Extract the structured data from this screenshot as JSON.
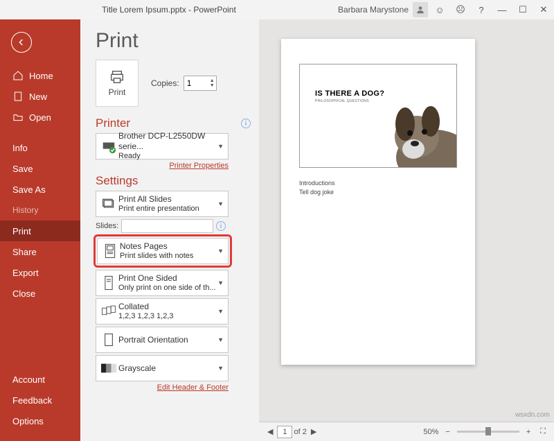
{
  "titlebar": {
    "title": "Title Lorem Ipsum.pptx - PowerPoint",
    "user": "Barbara Marystone"
  },
  "sidebar": {
    "back": "←",
    "top": [
      {
        "label": "Home",
        "icon": "home"
      },
      {
        "label": "New",
        "icon": "new"
      },
      {
        "label": "Open",
        "icon": "open"
      }
    ],
    "mid": [
      {
        "label": "Info"
      },
      {
        "label": "Save"
      },
      {
        "label": "Save As"
      },
      {
        "label": "History",
        "dim": true
      },
      {
        "label": "Print",
        "active": true
      },
      {
        "label": "Share"
      },
      {
        "label": "Export"
      },
      {
        "label": "Close"
      }
    ],
    "bottom": [
      {
        "label": "Account"
      },
      {
        "label": "Feedback"
      },
      {
        "label": "Options"
      }
    ]
  },
  "print": {
    "heading": "Print",
    "button": "Print",
    "copies_label": "Copies:",
    "copies_value": "1"
  },
  "printer": {
    "heading": "Printer",
    "name": "Brother DCP-L2550DW serie...",
    "status": "Ready",
    "link": "Printer Properties"
  },
  "settings": {
    "heading": "Settings",
    "range": {
      "title": "Print All Slides",
      "sub": "Print entire presentation"
    },
    "slides_label": "Slides:",
    "layout": {
      "title": "Notes Pages",
      "sub": "Print slides with notes"
    },
    "sides": {
      "title": "Print One Sided",
      "sub": "Only print on one side of th..."
    },
    "collate": {
      "title": "Collated",
      "sub": "1,2,3   1,2,3   1,2,3"
    },
    "orient": {
      "title": "Portrait Orientation",
      "sub": ""
    },
    "color": {
      "title": "Grayscale",
      "sub": ""
    },
    "link": "Edit Header & Footer"
  },
  "preview": {
    "slide_title": "IS THERE A DOG?",
    "slide_sub": "PHILOSOPHICAL QUESTIONS",
    "note1": "Introductions",
    "note2": "Tell dog joke"
  },
  "status": {
    "page": "1",
    "page_of": "of 2",
    "zoom": "50%"
  },
  "watermark": "wsxdn.com"
}
